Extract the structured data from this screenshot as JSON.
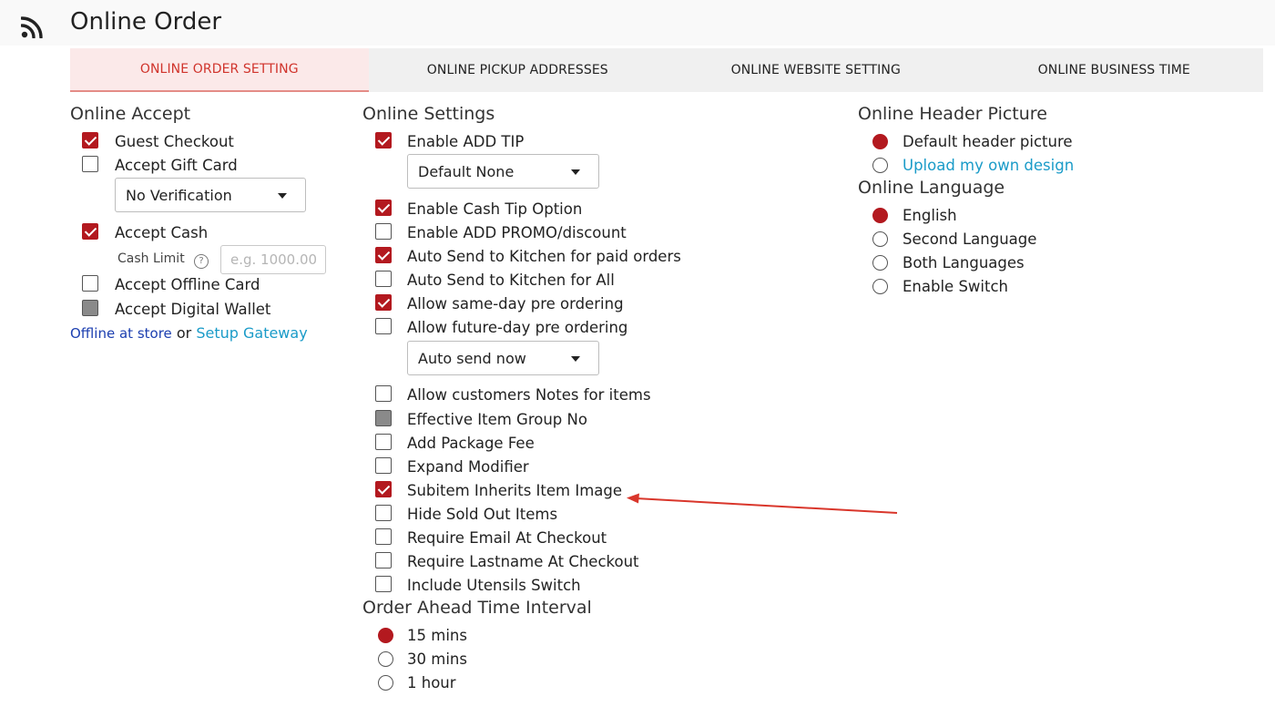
{
  "header": {
    "title": "Online Order",
    "icon": "rss-feed-icon"
  },
  "tabs": [
    {
      "label": "ONLINE ORDER SETTING",
      "active": true
    },
    {
      "label": "ONLINE PICKUP ADDRESSES",
      "active": false
    },
    {
      "label": "ONLINE WEBSITE SETTING",
      "active": false
    },
    {
      "label": "ONLINE BUSINESS TIME",
      "active": false
    }
  ],
  "colors": {
    "accent": "#b3191f",
    "active_tab_text": "#d0342c",
    "link": "#1a9bc8"
  },
  "online_accept": {
    "title": "Online Accept",
    "guest_checkout": {
      "label": "Guest Checkout",
      "checked": true
    },
    "gift_card": {
      "label": "Accept Gift Card",
      "checked": false
    },
    "verification_select": "No Verification",
    "cash": {
      "label": "Accept Cash",
      "checked": true
    },
    "cash_limit_label": "Cash Limit",
    "cash_limit_help": "?",
    "cash_limit_placeholder": "e.g. 1000.00",
    "offline_card": {
      "label": "Accept Offline Card",
      "checked": false
    },
    "digital_wallet": {
      "label": "Accept Digital Wallet",
      "checked": false,
      "disabled": true
    },
    "footer_offline": "Offline at store",
    "footer_or": "or",
    "footer_gateway": "Setup Gateway"
  },
  "online_settings": {
    "title": "Online Settings",
    "add_tip": {
      "label": "Enable ADD TIP",
      "checked": true
    },
    "tip_select": "Default None",
    "cash_tip": {
      "label": "Enable Cash Tip Option",
      "checked": true
    },
    "promo": {
      "label": "Enable ADD PROMO/discount",
      "checked": false
    },
    "auto_paid": {
      "label": "Auto Send to Kitchen for paid orders",
      "checked": true
    },
    "auto_all": {
      "label": "Auto Send to Kitchen for All",
      "checked": false
    },
    "same_day": {
      "label": "Allow same-day pre ordering",
      "checked": true
    },
    "future_day": {
      "label": "Allow future-day pre ordering",
      "checked": false
    },
    "send_select": "Auto send now",
    "notes": {
      "label": "Allow customers Notes for items",
      "checked": false
    },
    "item_group": {
      "label": "Effective Item Group No",
      "checked": false,
      "disabled": true
    },
    "package_fee": {
      "label": "Add Package Fee",
      "checked": false
    },
    "expand_modifier": {
      "label": "Expand Modifier",
      "checked": false
    },
    "subitem_image": {
      "label": "Subitem Inherits Item Image",
      "checked": true
    },
    "hide_sold_out": {
      "label": "Hide Sold Out Items",
      "checked": false
    },
    "require_email": {
      "label": "Require Email At Checkout",
      "checked": false
    },
    "require_lastname": {
      "label": "Require Lastname At Checkout",
      "checked": false
    },
    "utensils": {
      "label": "Include Utensils Switch",
      "checked": false
    }
  },
  "order_ahead": {
    "title": "Order Ahead Time Interval",
    "options": [
      {
        "label": "15 mins",
        "selected": true
      },
      {
        "label": "30 mins",
        "selected": false
      },
      {
        "label": "1 hour",
        "selected": false
      }
    ]
  },
  "header_picture": {
    "title": "Online Header Picture",
    "options": [
      {
        "label": "Default header picture",
        "selected": true
      },
      {
        "label": "Upload my own design",
        "selected": false
      }
    ]
  },
  "language": {
    "title": "Online Language",
    "options": [
      {
        "label": "English",
        "selected": true
      },
      {
        "label": "Second Language",
        "selected": false
      },
      {
        "label": "Both Languages",
        "selected": false
      },
      {
        "label": "Enable Switch",
        "selected": false
      }
    ]
  }
}
